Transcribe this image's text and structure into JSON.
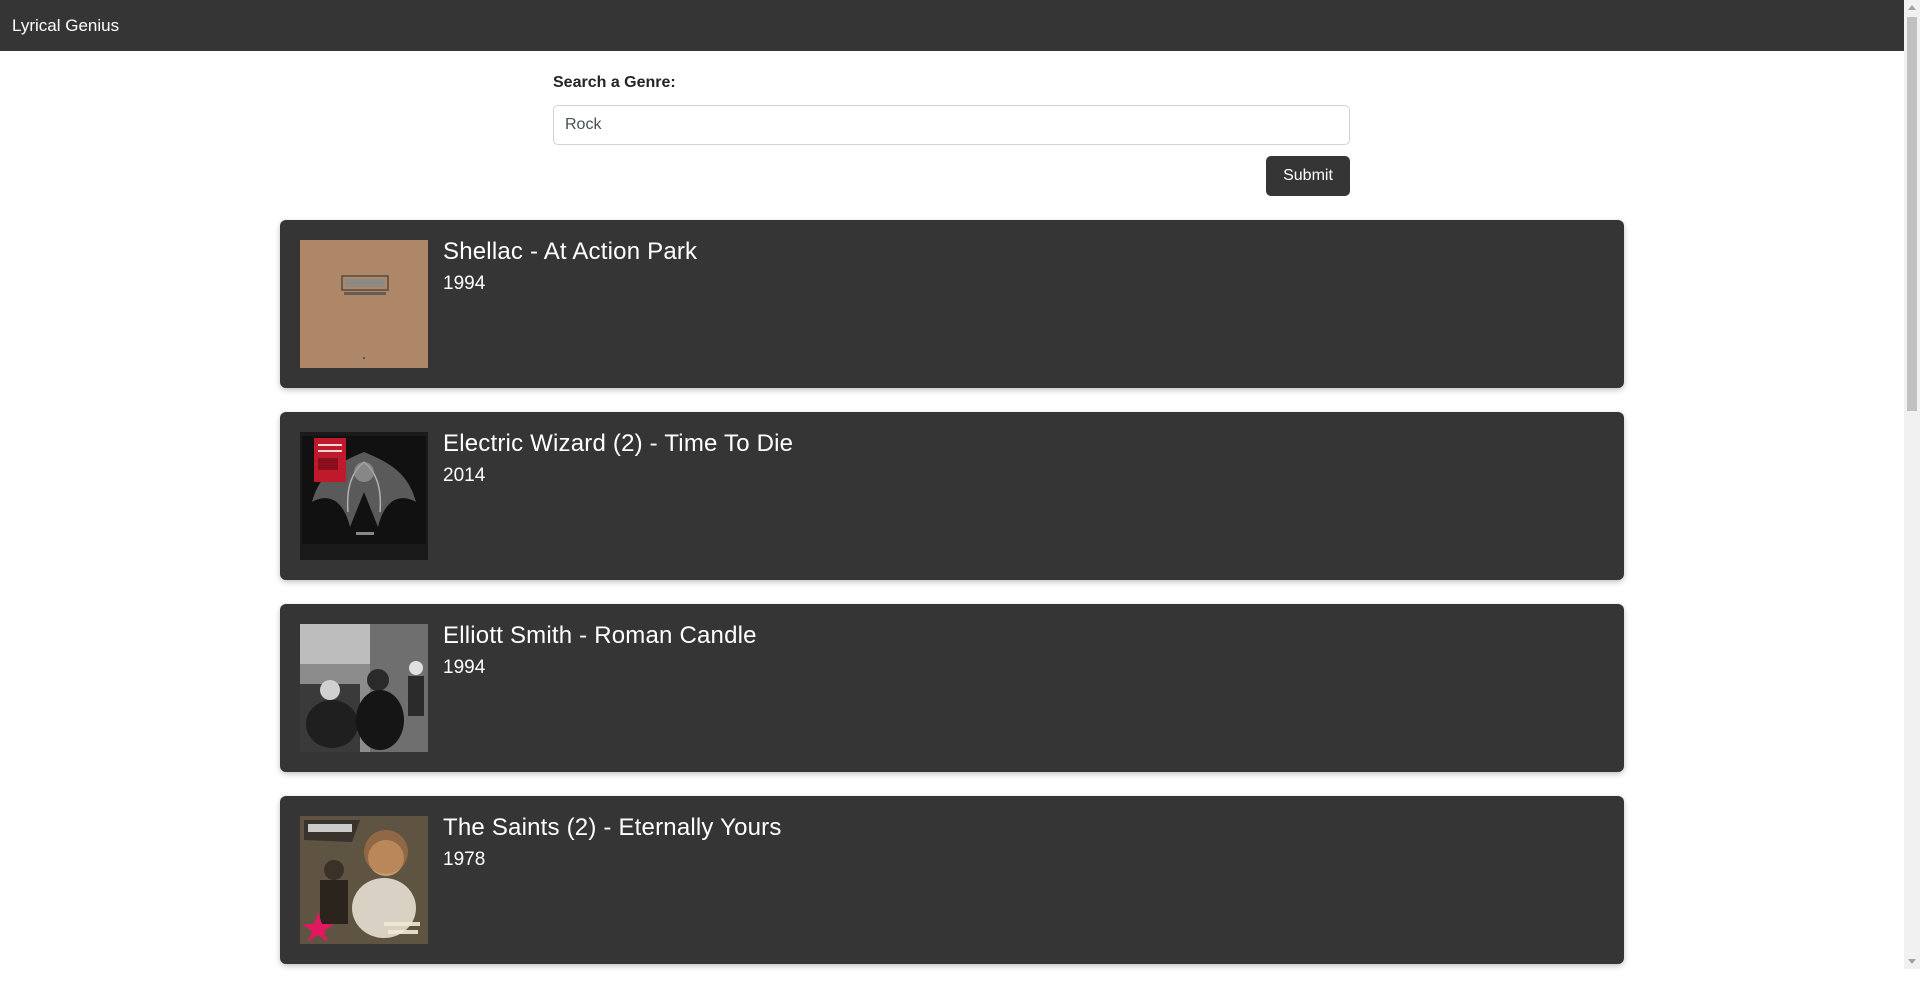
{
  "navbar": {
    "brand": "Lyrical Genius"
  },
  "search": {
    "label": "Search a Genre:",
    "value": "Rock",
    "submit_label": "Submit"
  },
  "results": [
    {
      "title": "Shellac - At Action Park",
      "year": "1994",
      "cover_icon": "album-cover-shellac"
    },
    {
      "title": "Electric Wizard (2) - Time To Die",
      "year": "2014",
      "cover_icon": "album-cover-electric-wizard"
    },
    {
      "title": "Elliott Smith - Roman Candle",
      "year": "1994",
      "cover_icon": "album-cover-elliott-smith"
    },
    {
      "title": "The Saints (2) - Eternally Yours",
      "year": "1978",
      "cover_icon": "album-cover-the-saints"
    }
  ],
  "colors": {
    "navbar_bg": "#353535",
    "card_bg": "#353535",
    "button_bg": "#353535",
    "text_light": "#ffffff"
  }
}
